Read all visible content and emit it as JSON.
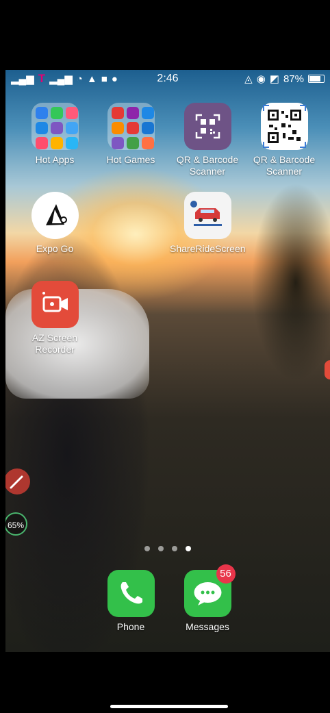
{
  "status": {
    "carrier": "T",
    "time": "2:46",
    "battery": "87%",
    "battery_level": 0.87
  },
  "apps": [
    {
      "id": "hot-apps",
      "label": "Hot Apps"
    },
    {
      "id": "hot-games",
      "label": "Hot Games"
    },
    {
      "id": "qr-1",
      "label": "QR & Barcode Scanner"
    },
    {
      "id": "qr-2",
      "label": "QR & Barcode Scanner"
    },
    {
      "id": "expo-go",
      "label": "Expo Go"
    },
    {
      "id": "shareride",
      "label": "ShareRideScreen"
    },
    {
      "id": "az-screen",
      "label": "AZ Screen Recorder"
    }
  ],
  "dock": {
    "phone_label": "Phone",
    "messages_label": "Messages",
    "messages_badge": "56"
  },
  "overlay": {
    "percent": "65%"
  },
  "page_indicator": {
    "count": 4,
    "active": 4
  },
  "colors": {
    "accent_red": "#e8354a",
    "green_app": "#33c04a",
    "qr_purple": "#6e5386",
    "carrier_magenta": "#e20074"
  }
}
